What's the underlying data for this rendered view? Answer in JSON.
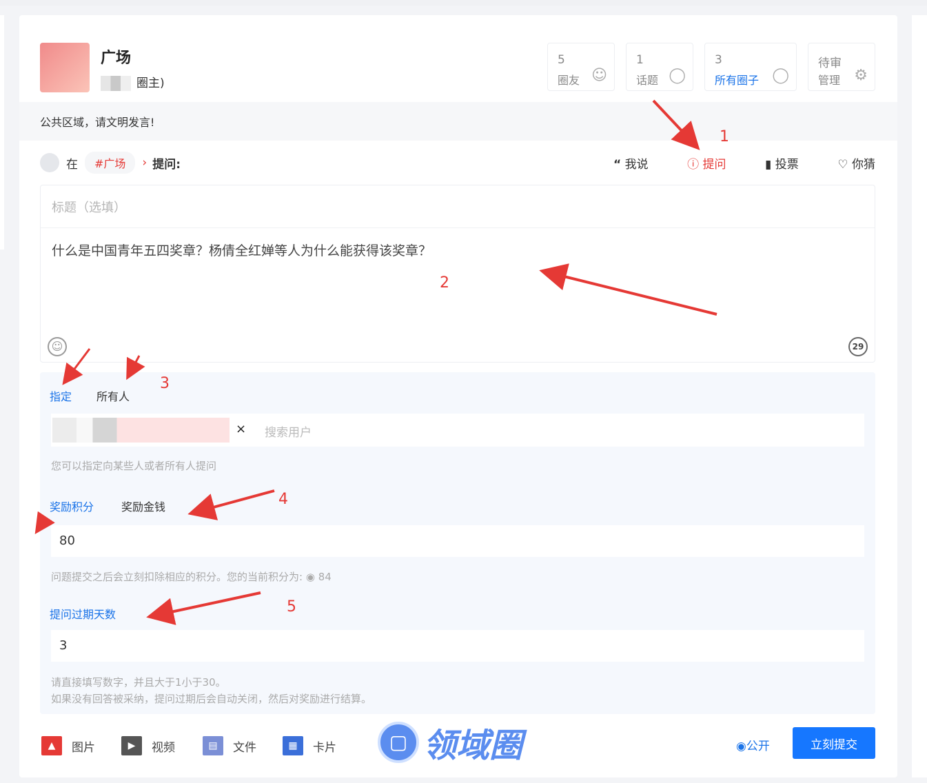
{
  "circle": {
    "name": "广场",
    "owner_suffix": "圈主)"
  },
  "stats": [
    {
      "count": "5",
      "label": "圈友",
      "icon": "users-icon"
    },
    {
      "count": "1",
      "label": "话题",
      "icon": "chat-icon"
    },
    {
      "count": "3",
      "label": "所有圈子",
      "icon": "circle-icon"
    },
    {
      "count": "待审",
      "label": "管理",
      "icon": "gear-icon"
    }
  ],
  "notice": "公共区域，请文明发言!",
  "composer": {
    "prefix": "在",
    "tag": "#广场",
    "chevron": "›",
    "mode_label": "提问:",
    "modes": [
      {
        "label": "我说",
        "icon": "quote-icon"
      },
      {
        "label": "提问",
        "icon": "question-icon",
        "active": true
      },
      {
        "label": "投票",
        "icon": "chart-icon"
      },
      {
        "label": "你猜",
        "icon": "heart-icon"
      }
    ],
    "title_placeholder": "标题（选填）",
    "body": "什么是中国青年五四奖章？杨倩全红婵等人为什么能获得该奖章？",
    "char_count": "29"
  },
  "target": {
    "options": [
      "指定",
      "所有人"
    ],
    "remove": "×",
    "search_placeholder": "搜索用户",
    "hint": "您可以指定向某些人或者所有人提问"
  },
  "reward": {
    "options": [
      "奖励积分",
      "奖励金钱"
    ],
    "value": "80",
    "hint": "问题提交之后会立刻扣除相应的积分。您的当前积分为:",
    "balance": "84"
  },
  "expire": {
    "label": "提问过期天数",
    "value": "3",
    "hint1": "请直接填写数字，并且大于1小于30。",
    "hint2": "如果没有回答被采纳，提问过期后会自动关闭，然后对奖励进行结算。"
  },
  "toolbar": {
    "items": [
      {
        "label": "图片",
        "icon": "image-icon",
        "color": "#e53935"
      },
      {
        "label": "视频",
        "icon": "video-icon",
        "color": "#555555"
      },
      {
        "label": "文件",
        "icon": "file-icon",
        "color": "#7b8fd6"
      },
      {
        "label": "卡片",
        "icon": "card-icon",
        "color": "#3b6fd9"
      }
    ],
    "visibility": "公开",
    "submit": "立刻提交"
  },
  "watermark": "领域圈",
  "annotations": [
    "1",
    "2",
    "3",
    "4",
    "5"
  ],
  "colors": {
    "accent_red": "#e53935",
    "accent_blue": "#1677ff"
  }
}
